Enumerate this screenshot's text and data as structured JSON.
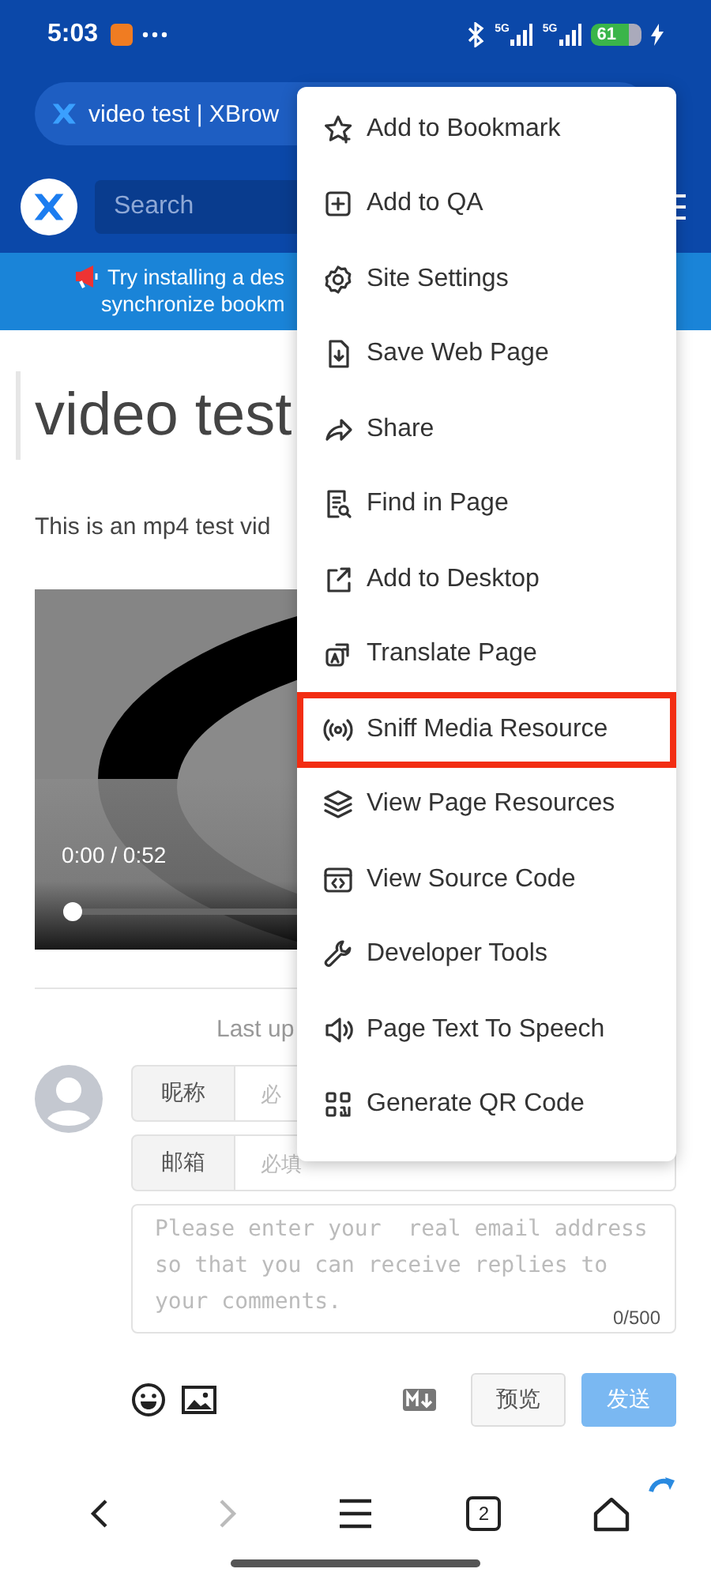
{
  "status_bar": {
    "time": "5:03",
    "network_labels": [
      "5G",
      "5G"
    ],
    "battery": "61"
  },
  "address_bar": {
    "title": "video test | XBrow"
  },
  "search": {
    "placeholder": "Search"
  },
  "banner": {
    "lines": [
      "Try installing a des",
      "synchronize bookm"
    ]
  },
  "article": {
    "title": "video test",
    "text": "This is an mp4 test vid",
    "video": {
      "time": "0:00 / 0:52",
      "level": 0
    },
    "updated": "Last up"
  },
  "comment_form": {
    "fields": [
      {
        "label": "昵称",
        "placeholder": "必"
      },
      {
        "label": "邮箱",
        "placeholder": "必填"
      }
    ],
    "textarea": {
      "placeholder": "Please enter your  real email address so that you can receive replies to your comments.",
      "count": "0/500"
    },
    "preview_button": "预览",
    "send_button": {
      "label": "发送",
      "disabled": true
    }
  },
  "menu": {
    "items": [
      {
        "label": "Add to Bookmark",
        "highlighted": false
      },
      {
        "label": "Add to QA",
        "highlighted": false
      },
      {
        "label": "Site Settings",
        "highlighted": false
      },
      {
        "label": "Save Web Page",
        "highlighted": false
      },
      {
        "label": "Share",
        "highlighted": false
      },
      {
        "label": "Find in Page",
        "highlighted": false
      },
      {
        "label": "Add to Desktop",
        "highlighted": false
      },
      {
        "label": "Translate Page",
        "highlighted": false
      },
      {
        "label": "Sniff Media Resource",
        "highlighted": true
      },
      {
        "label": "View Page Resources",
        "highlighted": false
      },
      {
        "label": "View Source Code",
        "highlighted": false
      },
      {
        "label": "Developer Tools",
        "highlighted": false
      },
      {
        "label": "Page Text To Speech",
        "highlighted": false
      },
      {
        "label": "Generate QR Code",
        "highlighted": false
      }
    ]
  },
  "bottom_nav": {
    "tabs_count": "2",
    "forward_disabled": true
  }
}
